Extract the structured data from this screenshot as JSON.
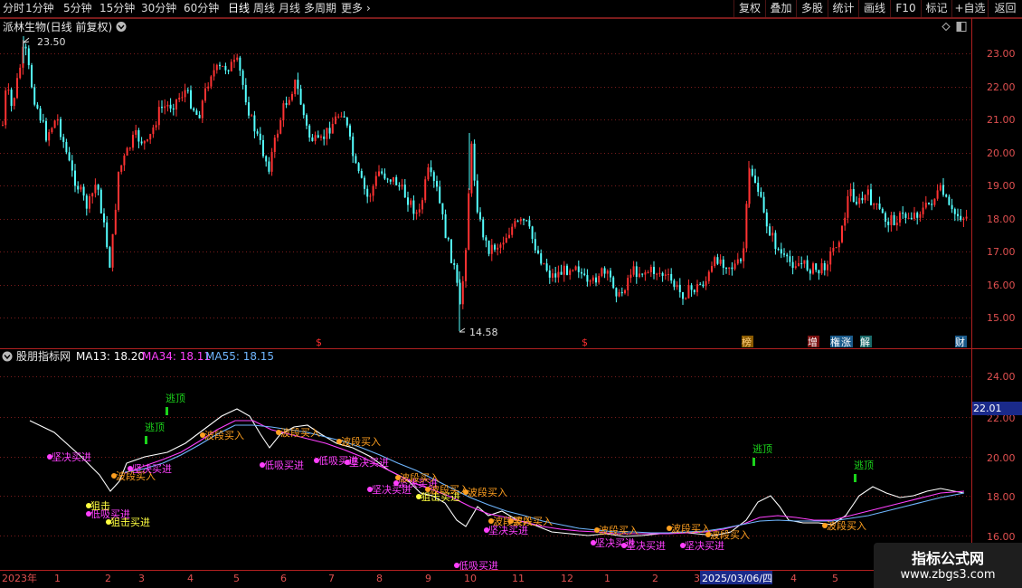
{
  "toolbar": {
    "periods": [
      "分时",
      "1分钟",
      "5分钟",
      "15分钟",
      "30分钟",
      "60分钟",
      "日线",
      "周线",
      "月线",
      "多周期",
      "更多"
    ],
    "active_period": "日线",
    "more_arrow": "›",
    "right_buttons": [
      "复权",
      "叠加",
      "多股",
      "统计",
      "画线",
      "F10",
      "标记",
      "+自选",
      "返回"
    ]
  },
  "main_panel": {
    "title": "派林生物(日线 前复权)",
    "dropdown_icon": "chevron-down-icon",
    "high_label": "23.50",
    "low_label": "14.58",
    "price_axis": [
      "23.00",
      "22.00",
      "21.00",
      "20.00",
      "19.00",
      "18.00",
      "17.00",
      "16.00",
      "15.00"
    ],
    "event_markers": [
      "$",
      "$",
      "榜",
      "增",
      "権",
      "涨",
      "解",
      "财"
    ]
  },
  "indicator_panel": {
    "title": "股朋指标网",
    "ma13_label": "MA13: 18.20",
    "ma34_label": "MA34: 18.11",
    "ma55_label": "MA55: 18.15",
    "axis": [
      "24.00",
      "22.00",
      "20.00",
      "18.00",
      "16.00"
    ],
    "current_value": "22.01",
    "signals": [
      {
        "text": "逃顶",
        "type": "top"
      },
      {
        "text": "逃顶",
        "type": "top"
      },
      {
        "text": "逃顶",
        "type": "top"
      },
      {
        "text": "逃顶",
        "type": "top"
      },
      {
        "text": "坚决买进",
        "type": "buy"
      },
      {
        "text": "波段买入",
        "type": "band"
      },
      {
        "text": "坚决买进",
        "type": "buy"
      },
      {
        "text": "低吸买进",
        "type": "buy"
      },
      {
        "text": "狙击",
        "type": "snipe"
      },
      {
        "text": "低吸买进",
        "type": "buy"
      },
      {
        "text": "狙击买进",
        "type": "snipe"
      },
      {
        "text": "波段买入",
        "type": "band"
      },
      {
        "text": "低吸买进",
        "type": "buy"
      },
      {
        "text": "波段买入",
        "type": "band"
      },
      {
        "text": "波段买入",
        "type": "band"
      },
      {
        "text": "坚决买进",
        "type": "buy"
      },
      {
        "text": "坚决买进",
        "type": "buy"
      },
      {
        "text": "坚决买进",
        "type": "buy"
      },
      {
        "text": "波段买入",
        "type": "band"
      },
      {
        "text": "狙击买进",
        "type": "snipe"
      },
      {
        "text": "波段买入",
        "type": "band"
      },
      {
        "text": "低吸买进",
        "type": "buy"
      },
      {
        "text": "波段买入",
        "type": "band"
      },
      {
        "text": "坚决买进",
        "type": "buy"
      },
      {
        "text": "波段买入",
        "type": "band"
      },
      {
        "text": "波段买入",
        "type": "band"
      },
      {
        "text": "坚决买进",
        "type": "buy"
      },
      {
        "text": "波段买入",
        "type": "band"
      },
      {
        "text": "坚决买进",
        "type": "buy"
      },
      {
        "text": "坚决买进",
        "type": "buy"
      },
      {
        "text": "波段买入",
        "type": "band"
      },
      {
        "text": "波段买入",
        "type": "band"
      },
      {
        "text": "波段买入",
        "type": "band"
      }
    ]
  },
  "time_axis": {
    "labels": [
      "2023年",
      "1",
      "2",
      "3",
      "4",
      "5",
      "6",
      "7",
      "8",
      "9",
      "10",
      "11",
      "12",
      "1",
      "2",
      "3",
      "4",
      "5",
      "6",
      "7"
    ],
    "cursor_date": "2025/03/06/四"
  },
  "watermark": {
    "title": "指标公式网",
    "url": "www.zbgs3.com"
  },
  "colors": {
    "up": "#ff3232",
    "down": "#54ffff",
    "grid": "#7a1c1c",
    "ma13": "#ffffff",
    "ma34": "#ff40ff",
    "ma55": "#6fb6ff",
    "top_signal": "#1bd41b",
    "buy_signal": "#ff40ff",
    "band_signal": "#ffa020",
    "snipe_signal": "#ffff40"
  }
}
